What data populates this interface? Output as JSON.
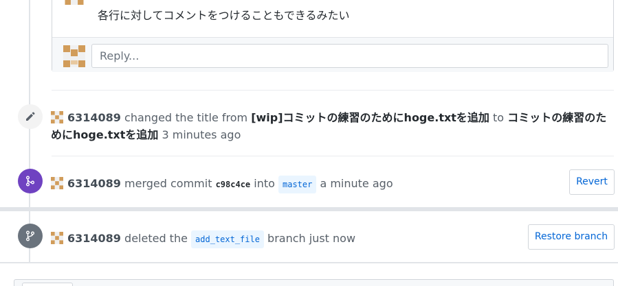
{
  "comment": {
    "text": "各行に対してコメントをつけることもできるみたい",
    "reply_placeholder": "Reply..."
  },
  "events": [
    {
      "user": "6314089",
      "action": "changed the title from",
      "old_title": "[wip]コミットの練習のためにhoge.txtを追加",
      "to": "to",
      "new_title_line1": "コミットの練習のた",
      "new_title_line2": "めにhoge.txtを追加",
      "time": "3 minutes ago",
      "icon": "pencil-icon"
    },
    {
      "user": "6314089",
      "action": "merged commit",
      "commit": "c98c4ce",
      "into": "into",
      "branch": "master",
      "time": "a minute ago",
      "button": "Revert",
      "icon": "git-merge-icon"
    },
    {
      "user": "6314089",
      "action": "deleted the",
      "branch": "add_text_file",
      "tail": "branch just now",
      "button": "Restore branch",
      "icon": "git-branch-icon"
    }
  ],
  "colors": {
    "merge_badge": "#6f42c1",
    "delete_badge": "#6a737d",
    "link": "#0366d6"
  }
}
